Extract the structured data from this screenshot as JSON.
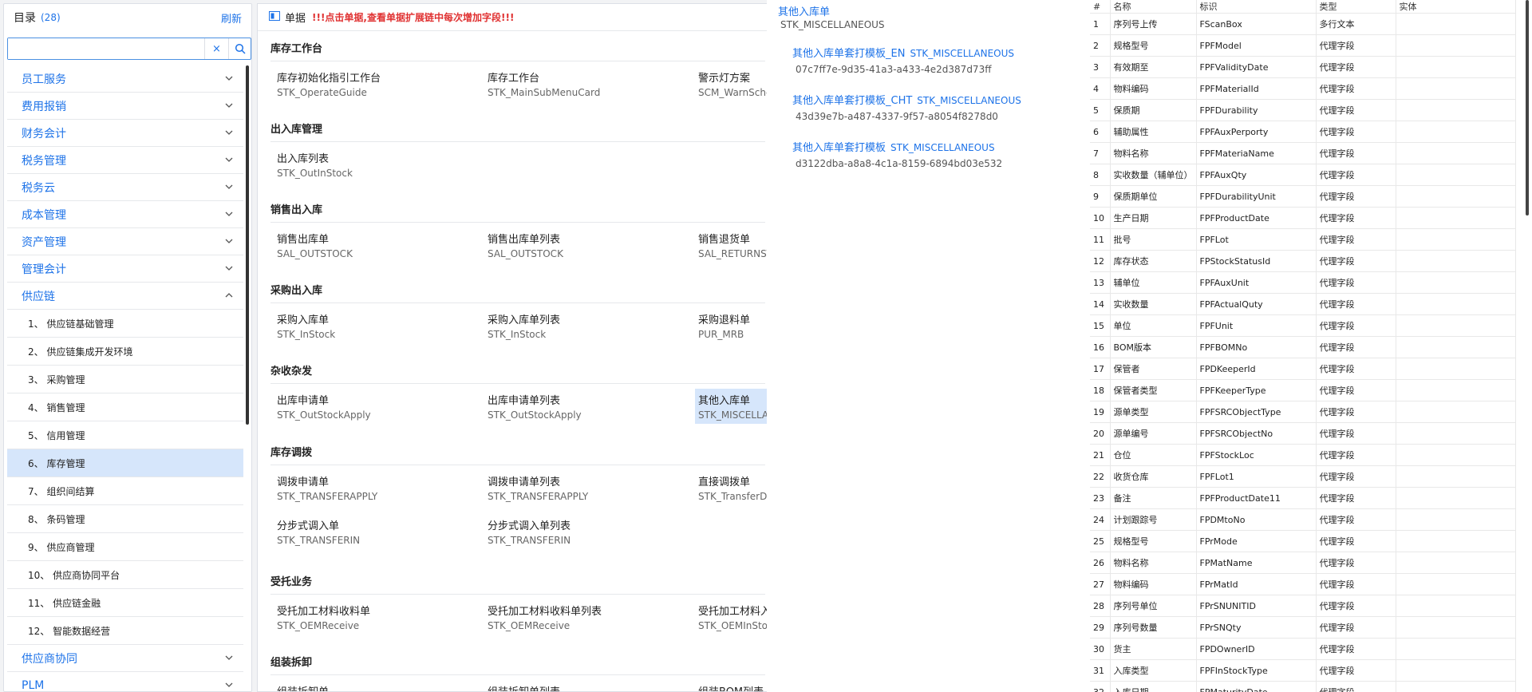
{
  "sidebar": {
    "title": "目录",
    "count": "(28)",
    "refresh": "刷新",
    "search_placeholder": "",
    "clear_icon": "×",
    "categories_top": [
      {
        "label": "员工服务"
      },
      {
        "label": "费用报销"
      },
      {
        "label": "财务会计"
      },
      {
        "label": "税务管理"
      },
      {
        "label": "税务云"
      },
      {
        "label": "成本管理"
      },
      {
        "label": "资产管理"
      },
      {
        "label": "管理会计"
      },
      {
        "label": "供应链"
      }
    ],
    "sub_items": [
      {
        "label": "1、 供应链基础管理"
      },
      {
        "label": "2、 供应链集成开发环境"
      },
      {
        "label": "3、 采购管理"
      },
      {
        "label": "4、 销售管理"
      },
      {
        "label": "5、 信用管理"
      },
      {
        "label": "6、 库存管理",
        "active": true
      },
      {
        "label": "7、 组织间结算"
      },
      {
        "label": "8、 条码管理"
      },
      {
        "label": "9、 供应商管理"
      },
      {
        "label": "10、 供应商协同平台"
      },
      {
        "label": "11、 供应链金融"
      },
      {
        "label": "12、 智能数据经营"
      }
    ],
    "categories_bottom": [
      {
        "label": "供应商协同"
      },
      {
        "label": "PLM"
      }
    ]
  },
  "middle": {
    "title": "单据",
    "warning": "!!!点击单据,查看单据扩展链中每次增加字段!!!",
    "groups": [
      {
        "title": "库存工作台",
        "items": [
          {
            "name": "库存初始化指引工作台",
            "code": "STK_OperateGuide"
          },
          {
            "name": "库存工作台",
            "code": "STK_MainSubMenuCard"
          },
          {
            "name": "警示灯方案",
            "code": "SCM_WarnScheme"
          }
        ]
      },
      {
        "title": "出入库管理",
        "items": [
          {
            "name": "出入库列表",
            "code": "STK_OutInStock"
          }
        ]
      },
      {
        "title": "销售出入库",
        "items": [
          {
            "name": "销售出库单",
            "code": "SAL_OUTSTOCK"
          },
          {
            "name": "销售出库单列表",
            "code": "SAL_OUTSTOCK"
          },
          {
            "name": "销售退货单",
            "code": "SAL_RETURNSTOCK"
          }
        ]
      },
      {
        "title": "采购出入库",
        "items": [
          {
            "name": "采购入库单",
            "code": "STK_InStock"
          },
          {
            "name": "采购入库单列表",
            "code": "STK_InStock"
          },
          {
            "name": "采购退料单",
            "code": "PUR_MRB"
          }
        ]
      },
      {
        "title": "杂收杂发",
        "items": [
          {
            "name": "出库申请单",
            "code": "STK_OutStockApply"
          },
          {
            "name": "出库申请单列表",
            "code": "STK_OutStockApply"
          },
          {
            "name": "其他入库单",
            "code": "STK_MISCELLANEOUS"
          }
        ]
      },
      {
        "title": "库存调拨",
        "items": [
          {
            "name": "调拨申请单",
            "code": "STK_TRANSFERAPPLY"
          },
          {
            "name": "调拨申请单列表",
            "code": "STK_TRANSFERAPPLY"
          },
          {
            "name": "直接调拨单",
            "code": "STK_TransferDirect"
          },
          {
            "name": "分步式调入单",
            "code": "STK_TRANSFERIN"
          },
          {
            "name": "分步式调入单列表",
            "code": "STK_TRANSFERIN"
          }
        ]
      },
      {
        "title": "受托业务",
        "items": [
          {
            "name": "受托加工材料收料单",
            "code": "STK_OEMReceive"
          },
          {
            "name": "受托加工材料收料单列表",
            "code": "STK_OEMReceive"
          },
          {
            "name": "受托加工材料入库单",
            "code": "STK_OEMInStock"
          }
        ]
      },
      {
        "title": "组装拆卸",
        "items": [
          {
            "name": "组装拆卸单",
            "code": ""
          },
          {
            "name": "组装拆卸单列表",
            "code": ""
          },
          {
            "name": "组装BOM列表",
            "code": ""
          }
        ]
      }
    ]
  },
  "popup": {
    "main_name": "其他入库单",
    "main_code": "STK_MISCELLANEOUS",
    "templates": [
      {
        "name": "其他入库单套打模板_EN",
        "code": "STK_MISCELLANEOUS",
        "id": "07c7ff7e-9d35-41a3-a433-4e2d387d73ff"
      },
      {
        "name": "其他入库单套打模板_CHT",
        "code": "STK_MISCELLANEOUS",
        "id": "43d39e7b-a487-4337-9f57-a8054f8278d0"
      },
      {
        "name": "其他入库单套打模板",
        "code": "STK_MISCELLANEOUS",
        "id": "d3122dba-a8a8-4c1a-8159-6894bd03e532"
      }
    ]
  },
  "fields": {
    "headers": [
      "#",
      "名称",
      "标识",
      "类型",
      "实体"
    ],
    "rows": [
      [
        "1",
        "序列号上传",
        "FScanBox",
        "多行文本",
        ""
      ],
      [
        "2",
        "规格型号",
        "FPFModel",
        "代理字段",
        ""
      ],
      [
        "3",
        "有效期至",
        "FPFValidityDate",
        "代理字段",
        ""
      ],
      [
        "4",
        "物料编码",
        "FPFMaterialId",
        "代理字段",
        ""
      ],
      [
        "5",
        "保质期",
        "FPFDurability",
        "代理字段",
        ""
      ],
      [
        "6",
        "辅助属性",
        "FPFAuxPerporty",
        "代理字段",
        ""
      ],
      [
        "7",
        "物料名称",
        "FPFMateriaName",
        "代理字段",
        ""
      ],
      [
        "8",
        "实收数量（辅单位）",
        "FPFAuxQty",
        "代理字段",
        ""
      ],
      [
        "9",
        "保质期单位",
        "FPFDurabilityUnit",
        "代理字段",
        ""
      ],
      [
        "10",
        "生产日期",
        "FPFProductDate",
        "代理字段",
        ""
      ],
      [
        "11",
        "批号",
        "FPFLot",
        "代理字段",
        ""
      ],
      [
        "12",
        "库存状态",
        "FPStockStatusId",
        "代理字段",
        ""
      ],
      [
        "13",
        "辅单位",
        "FPFAuxUnit",
        "代理字段",
        ""
      ],
      [
        "14",
        "实收数量",
        "FPFActualQuty",
        "代理字段",
        ""
      ],
      [
        "15",
        "单位",
        "FPFUnit",
        "代理字段",
        ""
      ],
      [
        "16",
        "BOM版本",
        "FPFBOMNo",
        "代理字段",
        ""
      ],
      [
        "17",
        "保管者",
        "FPDKeeperId",
        "代理字段",
        ""
      ],
      [
        "18",
        "保管者类型",
        "FPFKeeperType",
        "代理字段",
        ""
      ],
      [
        "19",
        "源单类型",
        "FPFSRCObjectType",
        "代理字段",
        ""
      ],
      [
        "20",
        "源单编号",
        "FPFSRCObjectNo",
        "代理字段",
        ""
      ],
      [
        "21",
        "仓位",
        "FPFStockLoc",
        "代理字段",
        ""
      ],
      [
        "22",
        "收货仓库",
        "FPFLot1",
        "代理字段",
        ""
      ],
      [
        "23",
        "备注",
        "FPFProductDate11",
        "代理字段",
        ""
      ],
      [
        "24",
        "计划跟踪号",
        "FPDMtoNo",
        "代理字段",
        ""
      ],
      [
        "25",
        "规格型号",
        "FPrMode",
        "代理字段",
        ""
      ],
      [
        "26",
        "物料名称",
        "FPMatName",
        "代理字段",
        ""
      ],
      [
        "27",
        "物料编码",
        "FPrMatId",
        "代理字段",
        ""
      ],
      [
        "28",
        "序列号单位",
        "FPrSNUNITID",
        "代理字段",
        ""
      ],
      [
        "29",
        "序列号数量",
        "FPrSNQty",
        "代理字段",
        ""
      ],
      [
        "30",
        "货主",
        "FPDOwnerID",
        "代理字段",
        ""
      ],
      [
        "31",
        "入库类型",
        "FPFInStockType",
        "代理字段",
        ""
      ],
      [
        "32",
        "入库日期",
        "FPMaturityDate",
        "代理字段",
        ""
      ]
    ]
  },
  "icons": {
    "chevron": "chevron-down-icon",
    "search": "search-icon",
    "doc": "document-icon"
  },
  "colors": {
    "accent": "#1e73e8",
    "warning": "#e03131",
    "active_bg": "#d6e6fb"
  }
}
